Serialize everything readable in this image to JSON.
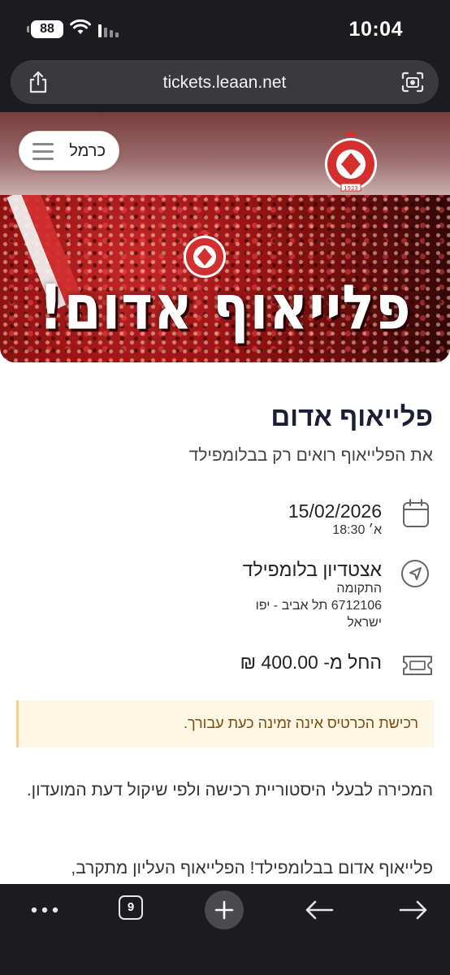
{
  "status_bar": {
    "battery": "88",
    "time": "10:04"
  },
  "browser": {
    "url": "tickets.leaan.net",
    "tab_count": "9",
    "icons": {
      "share": "share-icon",
      "camera": "camera-search-icon",
      "more": "more-dots-icon",
      "new_tab": "plus-icon",
      "back": "arrow-left-icon",
      "forward": "arrow-right-icon"
    }
  },
  "header": {
    "menu_label": "כרמל",
    "logo_alt": "Hapoel Tel-Aviv F.C. logo"
  },
  "banner": {
    "title": "פלייאוף אדום!"
  },
  "event": {
    "title": "פלייאוף אדום",
    "subtitle": "את הפלייאוף רואים רק בבלומפילד",
    "date": "15/02/2026",
    "day_time": "א׳ 18:30",
    "venue": "אצטדיון בלומפילד",
    "address_line1": "התקומה",
    "address_line2": "6712106 תל אביב - יפו",
    "country": "ישראל",
    "price": "החל מ- 400.00 ₪"
  },
  "notice": {
    "text": "רכישת הכרטיס אינה זמינה כעת עבורך."
  },
  "description": {
    "paragraph1": "המכירה לבעלי היסטוריית רכישה ולפי שיקול דעת המועדון.",
    "paragraph2": "פלייאוף אדום בבלומפילד! הפלייאוף העליון מתקרב,"
  },
  "colors": {
    "brand_red": "#d32f2f",
    "title_navy": "#1a1f36",
    "notice_bg": "#fdf6e3",
    "notice_text": "#7a4b12",
    "chrome_dark": "#1c1c1e"
  }
}
